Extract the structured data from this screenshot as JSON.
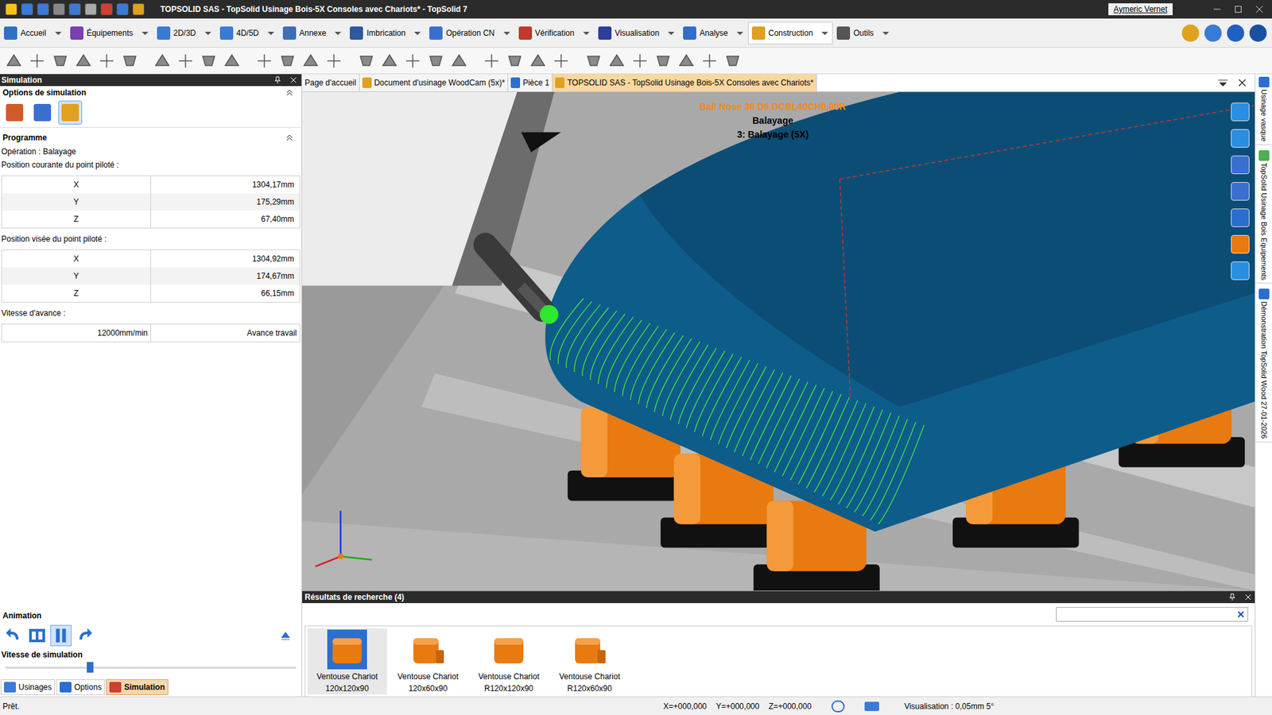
{
  "window": {
    "title": "TOPSOLID SAS - TopSolid Usinage Bois-5X Consoles avec Chariots* - TopSolid 7",
    "user": "Aymeric Vernet"
  },
  "ribbon_tabs": [
    {
      "label": "Accueil",
      "selected": false
    },
    {
      "label": "Équipements",
      "selected": false
    },
    {
      "label": "2D/3D",
      "selected": false
    },
    {
      "label": "4D/5D",
      "selected": false
    },
    {
      "label": "Annexe",
      "selected": false
    },
    {
      "label": "Imbrication",
      "selected": false
    },
    {
      "label": "Opération CN",
      "selected": false
    },
    {
      "label": "Vérification",
      "selected": false
    },
    {
      "label": "Visualisation",
      "selected": false
    },
    {
      "label": "Analyse",
      "selected": false
    },
    {
      "label": "Construction",
      "selected": true
    },
    {
      "label": "Outils",
      "selected": false
    }
  ],
  "left_panel": {
    "title": "Simulation",
    "options_title": "Options de simulation",
    "program_title": "Programme",
    "operation": "Opération : Balayage",
    "current_label": "Position courante du point piloté :",
    "current": [
      {
        "axis": "X",
        "value": "1304,17mm"
      },
      {
        "axis": "Y",
        "value": "175,29mm"
      },
      {
        "axis": "Z",
        "value": "67,40mm"
      }
    ],
    "target_label": "Position visée du point piloté :",
    "target": [
      {
        "axis": "X",
        "value": "1304,92mm"
      },
      {
        "axis": "Y",
        "value": "174,67mm"
      },
      {
        "axis": "Z",
        "value": "66,15mm"
      }
    ],
    "feed_label": "Vitesse d'avance :",
    "feed_value": "12000mm/min",
    "feed_mode": "Avance travail",
    "animation_title": "Animation",
    "speed_label": "Vitesse de simulation",
    "speed_level": 0.28,
    "bottom_tabs": [
      {
        "label": "Usinages",
        "selected": false
      },
      {
        "label": "Options",
        "selected": false
      },
      {
        "label": "Simulation",
        "selected": true
      }
    ]
  },
  "doc_tabs": [
    {
      "label": "Page d'accueil",
      "selected": false
    },
    {
      "label": "Document d'usinage WoodCam (5x)*",
      "selected": false
    },
    {
      "label": "Pièce 1",
      "selected": false
    },
    {
      "label": "TOPSOLID SAS - TopSolid Usinage Bois-5X Consoles avec Chariots*",
      "selected": true
    }
  ],
  "viewport": {
    "tool": "Ball Nose 38 D6 DCBL40CH0,00R",
    "operation": "Balayage",
    "step": "3: Balayage (5X)"
  },
  "side_tabs": [
    "Usinage vasque",
    "TopSolid Usinage Bois Equipements",
    "Démonstration TopSolid Wood 27-01-2026"
  ],
  "results": {
    "title": "Résultats de recherche (4)",
    "query": "",
    "items": [
      {
        "name": "Ventouse Chariot",
        "size": "120x120x90",
        "selected": true
      },
      {
        "name": "Ventouse Chariot",
        "size": "120x60x90",
        "selected": false
      },
      {
        "name": "Ventouse Chariot",
        "size": "R120x120x90",
        "selected": false
      },
      {
        "name": "Ventouse Chariot",
        "size": "R120x60x90",
        "selected": false
      }
    ]
  },
  "status_bar": {
    "message": "Prêt.",
    "x": "X=+000,000",
    "y": "Y=+000,000",
    "z": "Z=+000,000",
    "visualisation": "Visualisation : 0,05mm 5°"
  }
}
